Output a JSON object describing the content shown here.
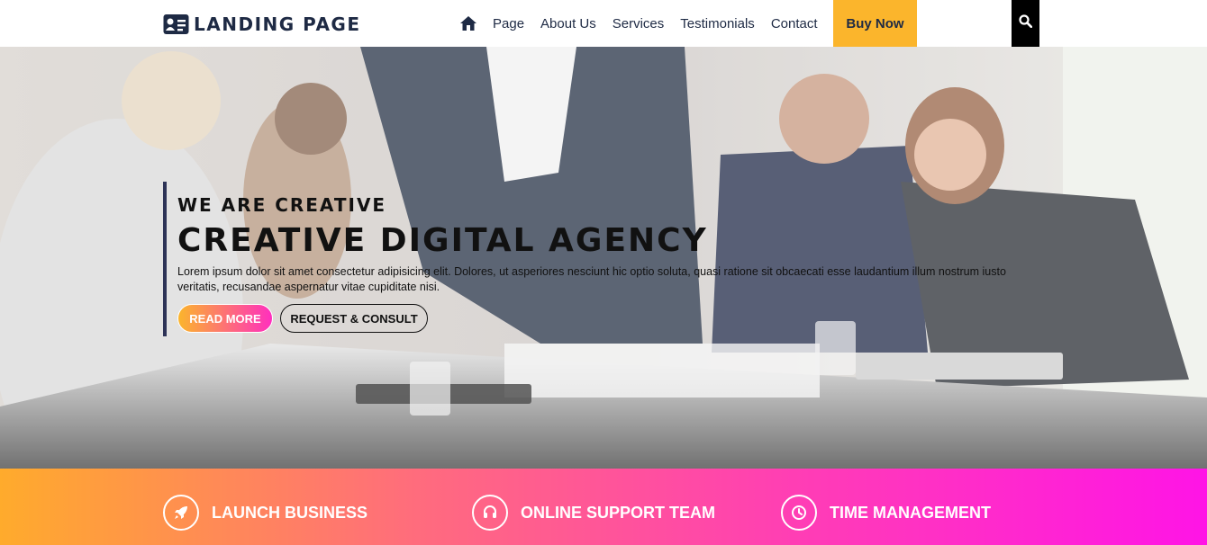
{
  "brand": {
    "icon": "id-card-icon",
    "text": "LANDING PAGE"
  },
  "nav": {
    "home_icon": "home-icon",
    "items": [
      "Page",
      "About Us",
      "Services",
      "Testimonials",
      "Contact"
    ],
    "cta": "Buy Now",
    "search_icon": "search-icon"
  },
  "hero": {
    "eyebrow": "WE ARE CREATIVE",
    "headline": "CREATIVE DIGITAL AGENCY",
    "description": "Lorem ipsum dolor sit amet consectetur adipisicing elit. Dolores, ut asperiores nesciunt hic optio soluta, quasi ratione sit obcaecati esse laudantium illum nostrum iusto veritatis, recusandae aspernatur vitae cupiditate nisi.",
    "primary_button": "READ MORE",
    "secondary_button": "REQUEST & CONSULT"
  },
  "features": [
    {
      "icon": "rocket-icon",
      "label": "LAUNCH BUSINESS"
    },
    {
      "icon": "headset-icon",
      "label": "ONLINE SUPPORT TEAM"
    },
    {
      "icon": "clock-icon",
      "label": "TIME MANAGEMENT"
    }
  ],
  "colors": {
    "accent_yellow": "#fbb52c",
    "accent_pink": "#ff14e6",
    "navy": "#1e2a44"
  }
}
